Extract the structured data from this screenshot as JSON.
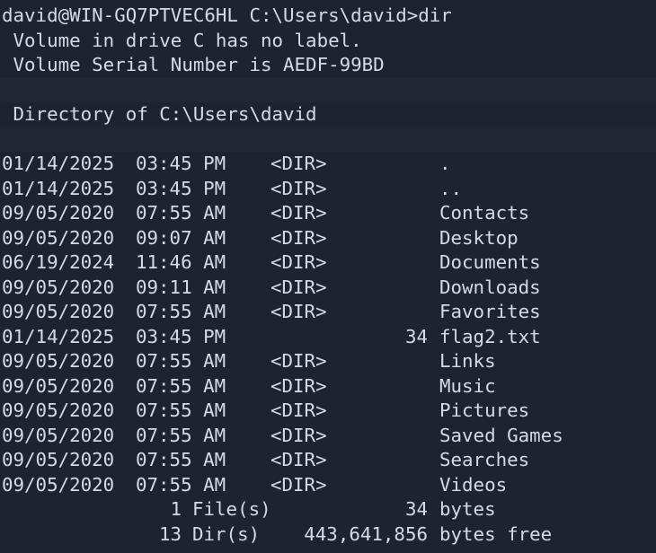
{
  "prompt": "david@WIN-GQ7PTVEC6HL C:\\Users\\david>dir",
  "volume_label_line": " Volume in drive C has no label.",
  "volume_serial_line": " Volume Serial Number is AEDF-99BD",
  "directory_line": " Directory of C:\\Users\\david",
  "entries": [
    {
      "date": "01/14/2025",
      "time": "03:45 PM",
      "type": "<DIR>",
      "size": "",
      "name": "."
    },
    {
      "date": "01/14/2025",
      "time": "03:45 PM",
      "type": "<DIR>",
      "size": "",
      "name": ".."
    },
    {
      "date": "09/05/2020",
      "time": "07:55 AM",
      "type": "<DIR>",
      "size": "",
      "name": "Contacts"
    },
    {
      "date": "09/05/2020",
      "time": "09:07 AM",
      "type": "<DIR>",
      "size": "",
      "name": "Desktop"
    },
    {
      "date": "06/19/2024",
      "time": "11:46 AM",
      "type": "<DIR>",
      "size": "",
      "name": "Documents"
    },
    {
      "date": "09/05/2020",
      "time": "09:11 AM",
      "type": "<DIR>",
      "size": "",
      "name": "Downloads"
    },
    {
      "date": "09/05/2020",
      "time": "07:55 AM",
      "type": "<DIR>",
      "size": "",
      "name": "Favorites"
    },
    {
      "date": "01/14/2025",
      "time": "03:45 PM",
      "type": "",
      "size": "34",
      "name": "flag2.txt"
    },
    {
      "date": "09/05/2020",
      "time": "07:55 AM",
      "type": "<DIR>",
      "size": "",
      "name": "Links"
    },
    {
      "date": "09/05/2020",
      "time": "07:55 AM",
      "type": "<DIR>",
      "size": "",
      "name": "Music"
    },
    {
      "date": "09/05/2020",
      "time": "07:55 AM",
      "type": "<DIR>",
      "size": "",
      "name": "Pictures"
    },
    {
      "date": "09/05/2020",
      "time": "07:55 AM",
      "type": "<DIR>",
      "size": "",
      "name": "Saved Games"
    },
    {
      "date": "09/05/2020",
      "time": "07:55 AM",
      "type": "<DIR>",
      "size": "",
      "name": "Searches"
    },
    {
      "date": "09/05/2020",
      "time": "07:55 AM",
      "type": "<DIR>",
      "size": "",
      "name": "Videos"
    }
  ],
  "summary": {
    "files_count": "1",
    "files_label": "File(s)",
    "files_bytes": "34",
    "files_unit": "bytes",
    "dirs_count": "13",
    "dirs_label": "Dir(s)",
    "dirs_bytes": "443,641,856",
    "dirs_unit": "bytes free"
  },
  "colors": {
    "background": "#1d2430",
    "band": "#202836",
    "text": "#d6dbe3"
  }
}
